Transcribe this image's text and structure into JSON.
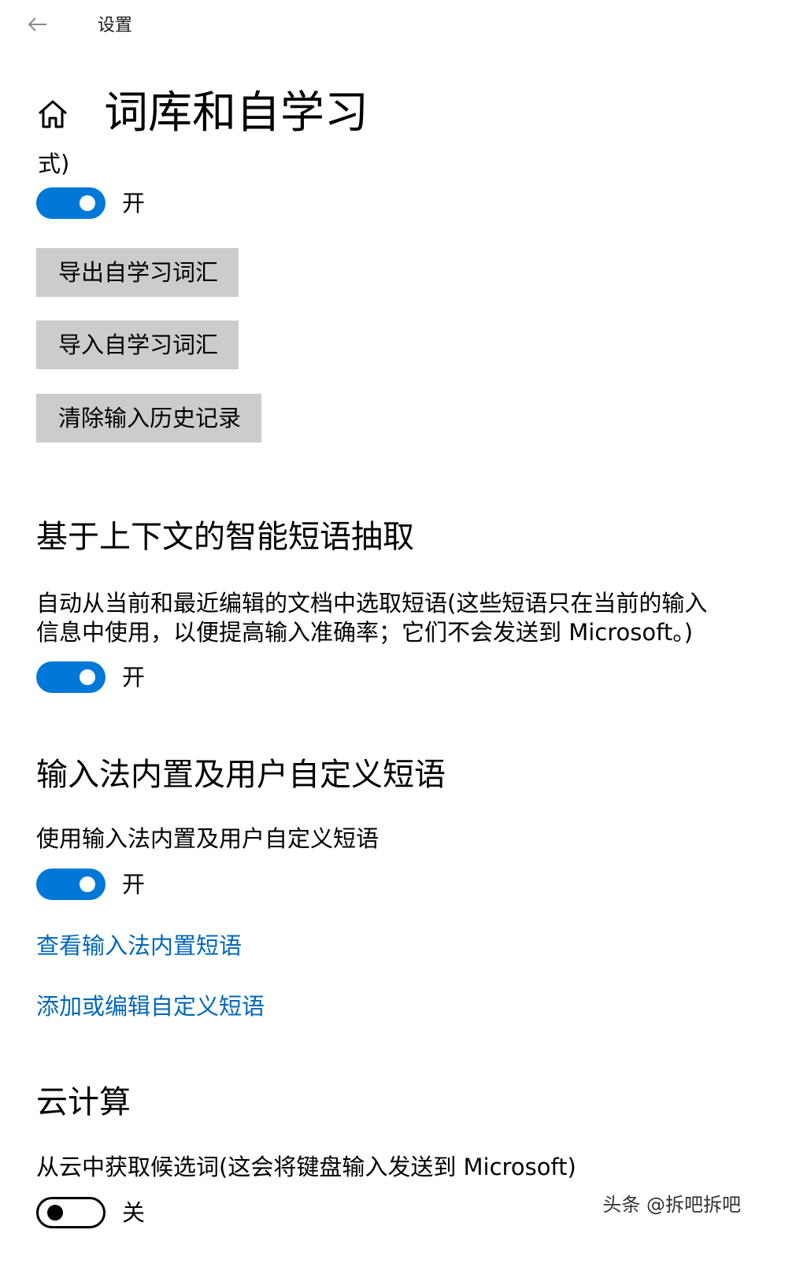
{
  "titlebar": {
    "back_icon": "back-arrow-icon",
    "app_title": "设置"
  },
  "header": {
    "home_icon": "home-icon",
    "title": "词库和自学习",
    "truncated_text": "式)"
  },
  "self_learning": {
    "toggle": {
      "state": "on",
      "label": "开"
    },
    "buttons": [
      {
        "label": "导出自学习词汇"
      },
      {
        "label": "导入自学习词汇"
      },
      {
        "label": "清除输入历史记录"
      }
    ]
  },
  "context_phrases": {
    "heading": "基于上下文的智能短语抽取",
    "description_line1": "自动从当前和最近编辑的文档中选取短语(这些短语只在当前的输入",
    "description_line2": "信息中使用，以便提高输入准确率；它们不会发送到 Microsoft。)",
    "toggle": {
      "state": "on",
      "label": "开"
    }
  },
  "builtin_phrases": {
    "heading": "输入法内置及用户自定义短语",
    "description": "使用输入法内置及用户自定义短语",
    "toggle": {
      "state": "on",
      "label": "开"
    },
    "links": [
      {
        "label": "查看输入法内置短语"
      },
      {
        "label": "添加或编辑自定义短语"
      }
    ]
  },
  "cloud": {
    "heading": "云计算",
    "description": "从云中获取候选词(这会将键盘输入发送到 Microsoft)",
    "toggle": {
      "state": "off",
      "label": "关"
    }
  },
  "watermark": "头条 @拆吧拆吧",
  "colors": {
    "accent": "#0078d7",
    "link": "#0067b8",
    "button_bg": "#cccccc"
  }
}
